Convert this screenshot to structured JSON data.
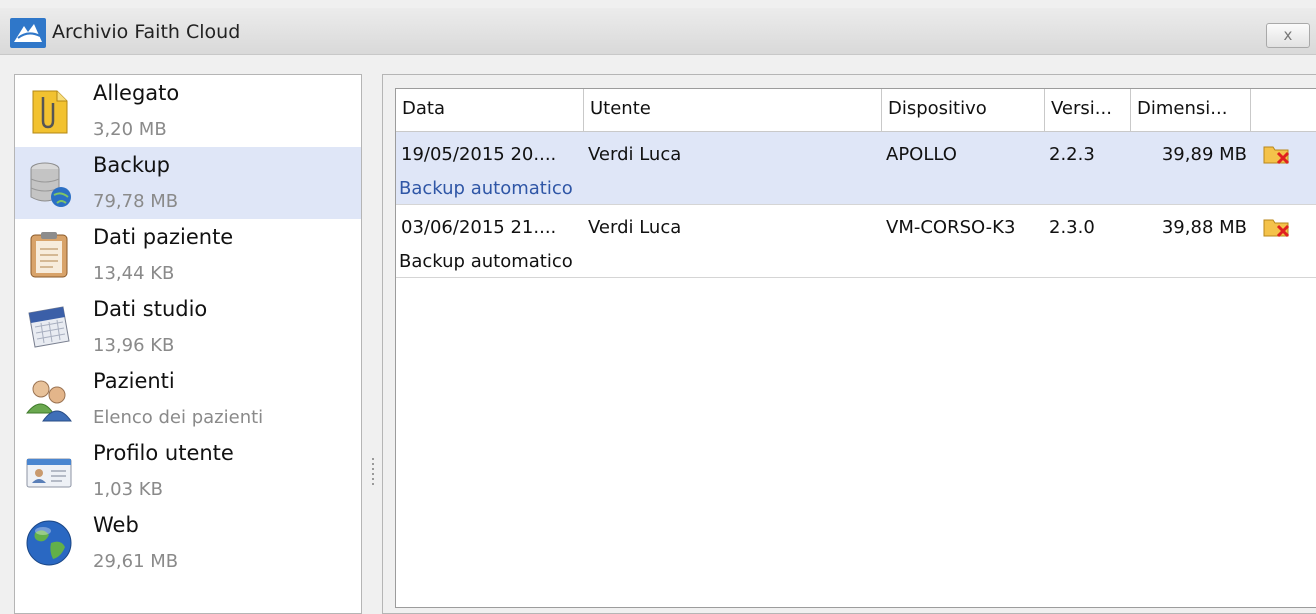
{
  "window": {
    "title": "Archivio Faith Cloud",
    "close_label": "x"
  },
  "sidebar": {
    "items": [
      {
        "label": "Allegato",
        "sub": "3,20 MB",
        "icon": "attachment-icon",
        "selected": false
      },
      {
        "label": "Backup",
        "sub": "79,78 MB",
        "icon": "database-globe-icon",
        "selected": true
      },
      {
        "label": "Dati paziente",
        "sub": "13,44 KB",
        "icon": "clipboard-icon",
        "selected": false
      },
      {
        "label": "Dati studio",
        "sub": "13,96 KB",
        "icon": "calendar-icon",
        "selected": false
      },
      {
        "label": "Pazienti",
        "sub": "Elenco dei pazienti",
        "icon": "users-icon",
        "selected": false
      },
      {
        "label": "Profilo utente",
        "sub": "1,03 KB",
        "icon": "id-card-icon",
        "selected": false
      },
      {
        "label": "Web",
        "sub": "29,61 MB",
        "icon": "globe-icon",
        "selected": false
      }
    ]
  },
  "grid": {
    "columns": [
      "Data",
      "Utente",
      "Dispositivo",
      "Versi...",
      "Dimensi..."
    ],
    "rows": [
      {
        "data": "19/05/2015 20....",
        "utente": "Verdi Luca",
        "dispositivo": "APOLLO",
        "versione": "2.2.3",
        "dimensione": "39,89 MB",
        "note": "Backup automatico",
        "selected": true
      },
      {
        "data": "03/06/2015 21....",
        "utente": "Verdi Luca",
        "dispositivo": "VM-CORSO-K3",
        "versione": "2.3.0",
        "dimensione": "39,88 MB",
        "note": "Backup automatico",
        "selected": false
      }
    ],
    "row_action_icon": "delete-folder-icon"
  }
}
